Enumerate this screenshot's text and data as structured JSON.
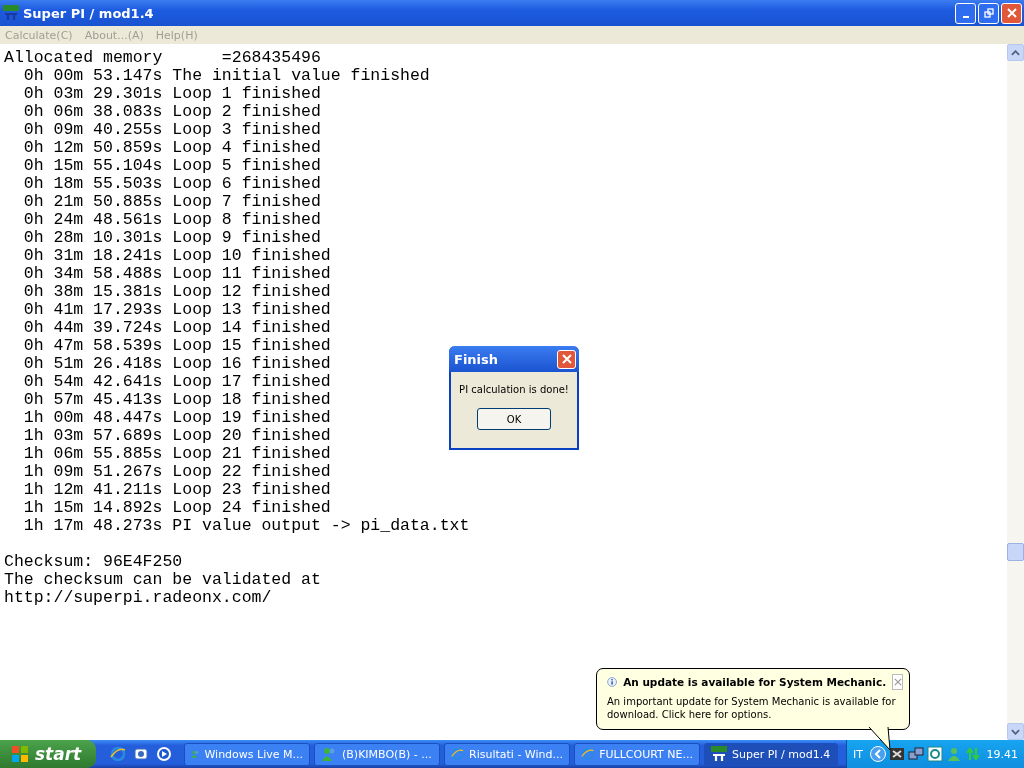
{
  "window": {
    "title": "Super PI / mod1.4"
  },
  "menu": [
    {
      "label": "Calculate(C)",
      "disabled": true
    },
    {
      "label": "About...(A)",
      "disabled": true
    },
    {
      "label": "Help(H)",
      "disabled": true
    }
  ],
  "output_lines": [
    "Allocated memory      =268435496",
    "  0h 00m 53.147s The initial value finished",
    "  0h 03m 29.301s Loop 1 finished",
    "  0h 06m 38.083s Loop 2 finished",
    "  0h 09m 40.255s Loop 3 finished",
    "  0h 12m 50.859s Loop 4 finished",
    "  0h 15m 55.104s Loop 5 finished",
    "  0h 18m 55.503s Loop 6 finished",
    "  0h 21m 50.885s Loop 7 finished",
    "  0h 24m 48.561s Loop 8 finished",
    "  0h 28m 10.301s Loop 9 finished",
    "  0h 31m 18.241s Loop 10 finished",
    "  0h 34m 58.488s Loop 11 finished",
    "  0h 38m 15.381s Loop 12 finished",
    "  0h 41m 17.293s Loop 13 finished",
    "  0h 44m 39.724s Loop 14 finished",
    "  0h 47m 58.539s Loop 15 finished",
    "  0h 51m 26.418s Loop 16 finished",
    "  0h 54m 42.641s Loop 17 finished",
    "  0h 57m 45.413s Loop 18 finished",
    "  1h 00m 48.447s Loop 19 finished",
    "  1h 03m 57.689s Loop 20 finished",
    "  1h 06m 55.885s Loop 21 finished",
    "  1h 09m 51.267s Loop 22 finished",
    "  1h 12m 41.211s Loop 23 finished",
    "  1h 15m 14.892s Loop 24 finished",
    "  1h 17m 48.273s PI value output -> pi_data.txt"
  ],
  "checksum_lines": [
    "Checksum: 96E4F250",
    "The checksum can be validated at",
    "http://superpi.radeonx.com/"
  ],
  "dialog": {
    "title": "Finish",
    "message": "PI calculation is done!",
    "button": "OK"
  },
  "balloon": {
    "title": "An update is available for System Mechanic.",
    "body": "An important update for System Mechanic is available for download.  Click here for options."
  },
  "taskbar": {
    "start": "start",
    "tasks": [
      {
        "label": "Windows Live M...",
        "kind": "messenger",
        "selected": false
      },
      {
        "label": "(B)KIMBO(B) - ...",
        "kind": "messenger",
        "selected": false
      },
      {
        "label": "Risultati - Wind...",
        "kind": "browser",
        "selected": false
      },
      {
        "label": "FULLCOURT NE...",
        "kind": "browser",
        "selected": false
      },
      {
        "label": "Super PI / mod1.4",
        "kind": "superpi",
        "selected": true
      }
    ],
    "language": "IT",
    "clock": "19.41"
  }
}
